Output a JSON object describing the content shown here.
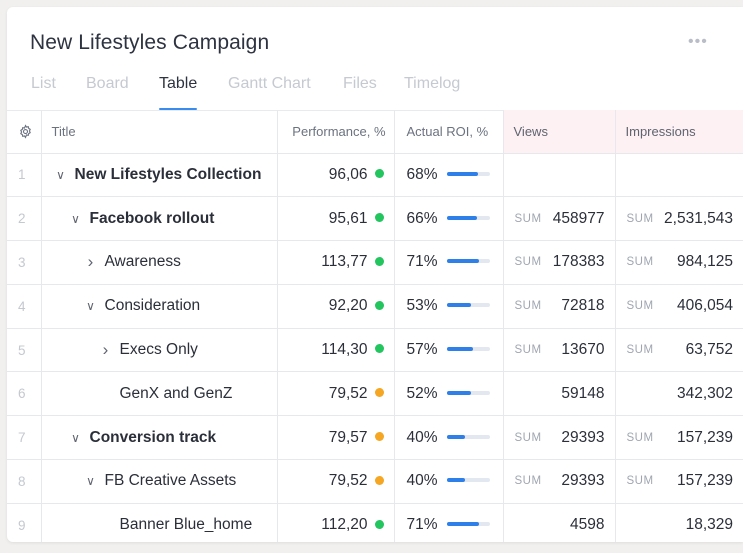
{
  "header": {
    "title": "New Lifestyles Campaign",
    "more_icon": "more-horizontal-icon",
    "more_label": "•••"
  },
  "tabs": [
    {
      "label": "List"
    },
    {
      "label": "Board"
    },
    {
      "label": "Table",
      "active": true
    },
    {
      "label": "Gantt Chart"
    },
    {
      "label": "Files"
    },
    {
      "label": "Timelog"
    }
  ],
  "table": {
    "settings_icon": "gear-icon",
    "columns": {
      "title": "Title",
      "performance": "Performance, %",
      "roi": "Actual ROI, %",
      "views": "Views",
      "impressions": "Impressions"
    },
    "sum_label": "SUM",
    "colors": {
      "accent": "#3a8bf0",
      "bar": "#2f7fe8",
      "good": "#22c55e",
      "warn": "#f5a623",
      "pink_header": "#fdf1f3"
    },
    "rows": [
      {
        "num": "1",
        "title": "New Lifestyles Collection",
        "chevron": "down",
        "bold": true,
        "perf": "96,06",
        "status": "good",
        "roi": "68%",
        "roi_pct": 68,
        "views": "",
        "impressions": "",
        "views_sum": false,
        "imp_sum": false
      },
      {
        "num": "2",
        "title": "Facebook rollout",
        "chevron": "down",
        "bold": true,
        "perf": "95,61",
        "status": "good",
        "roi": "66%",
        "roi_pct": 66,
        "views": "458977",
        "impressions": "2,531,543",
        "views_sum": true,
        "imp_sum": true
      },
      {
        "num": "3",
        "title": "Awareness",
        "chevron": "right",
        "bold": false,
        "perf": "113,77",
        "status": "good",
        "roi": "71%",
        "roi_pct": 71,
        "views": "178383",
        "impressions": "984,125",
        "views_sum": true,
        "imp_sum": true
      },
      {
        "num": "4",
        "title": "Consideration",
        "chevron": "down",
        "bold": false,
        "perf": "92,20",
        "status": "good",
        "roi": "53%",
        "roi_pct": 53,
        "views": "72818",
        "impressions": "406,054",
        "views_sum": true,
        "imp_sum": true
      },
      {
        "num": "5",
        "title": "Execs Only",
        "chevron": "right",
        "bold": false,
        "perf": "114,30",
        "status": "good",
        "roi": "57%",
        "roi_pct": 57,
        "views": "13670",
        "impressions": "63,752",
        "views_sum": true,
        "imp_sum": true
      },
      {
        "num": "6",
        "title": "GenX and GenZ",
        "chevron": "none",
        "bold": false,
        "perf": "79,52",
        "status": "warn",
        "roi": "52%",
        "roi_pct": 52,
        "views": "59148",
        "impressions": "342,302",
        "views_sum": false,
        "imp_sum": false
      },
      {
        "num": "7",
        "title": "Conversion track",
        "chevron": "down",
        "bold": true,
        "perf": "79,57",
        "status": "warn",
        "roi": "40%",
        "roi_pct": 40,
        "views": "29393",
        "impressions": "157,239",
        "views_sum": true,
        "imp_sum": true
      },
      {
        "num": "8",
        "title": "FB Creative Assets",
        "chevron": "down",
        "bold": false,
        "perf": "79,52",
        "status": "warn",
        "roi": "40%",
        "roi_pct": 40,
        "views": "29393",
        "impressions": "157,239",
        "views_sum": true,
        "imp_sum": true
      },
      {
        "num": "9",
        "title": "Banner Blue_home",
        "chevron": "none",
        "bold": false,
        "perf": "112,20",
        "status": "good",
        "roi": "71%",
        "roi_pct": 71,
        "views": "4598",
        "impressions": "18,329",
        "views_sum": false,
        "imp_sum": false
      }
    ]
  }
}
